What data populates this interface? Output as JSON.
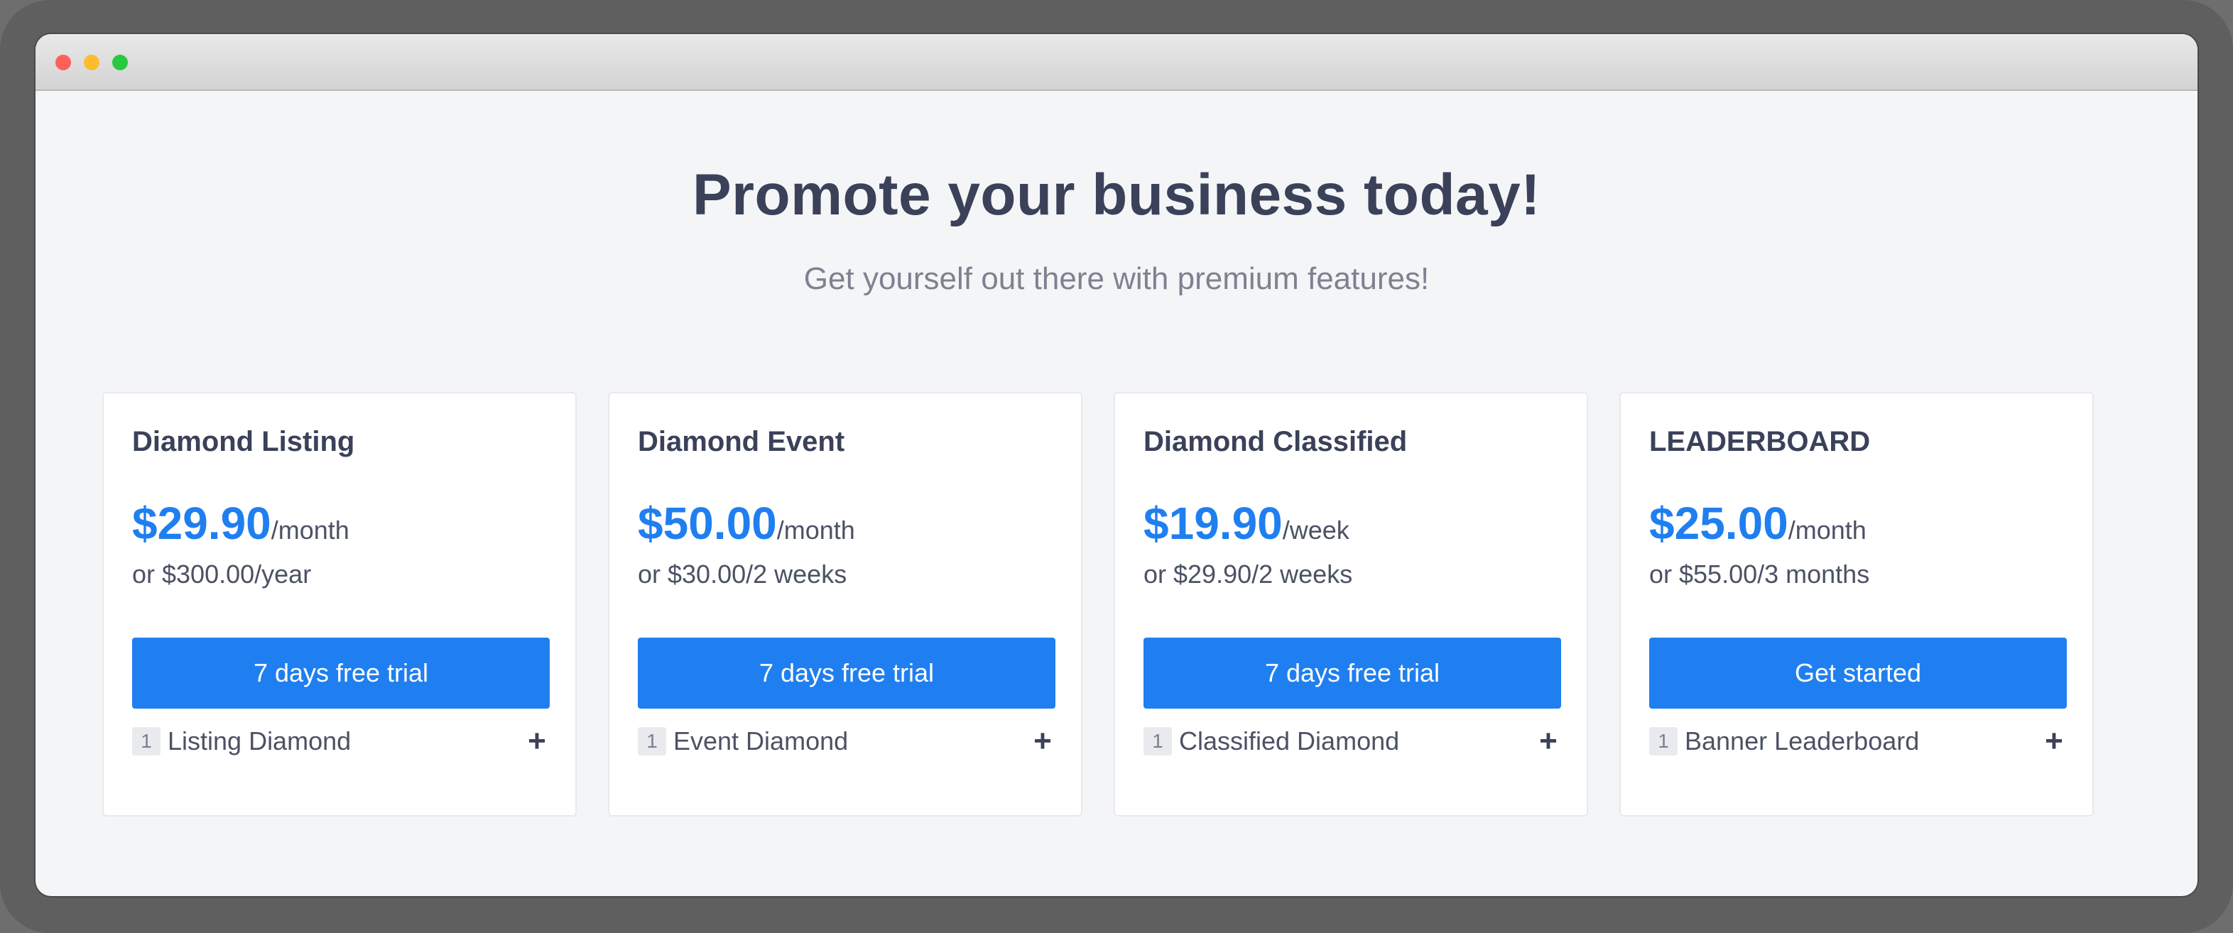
{
  "window": {
    "controls": [
      "close",
      "minimize",
      "maximize"
    ]
  },
  "hero": {
    "title": "Promote your business today!",
    "subtitle": "Get yourself out there with premium features!"
  },
  "plans": [
    {
      "name": "Diamond Listing",
      "price": "$29.90",
      "period": "/month",
      "alt_price": "or $300.00/year",
      "cta": "7 days free trial",
      "feature_qty": "1",
      "feature_label": "Listing Diamond"
    },
    {
      "name": "Diamond Event",
      "price": "$50.00",
      "period": "/month",
      "alt_price": "or $30.00/2 weeks",
      "cta": "7 days free trial",
      "feature_qty": "1",
      "feature_label": "Event Diamond"
    },
    {
      "name": "Diamond Classified",
      "price": "$19.90",
      "period": "/week",
      "alt_price": "or $29.90/2 weeks",
      "cta": "7 days free trial",
      "feature_qty": "1",
      "feature_label": "Classified Diamond"
    },
    {
      "name": "LEADERBOARD",
      "price": "$25.00",
      "period": "/month",
      "alt_price": "or $55.00/3 months",
      "cta": "Get started",
      "feature_qty": "1",
      "feature_label": "Banner Leaderboard"
    }
  ],
  "icons": {
    "expand": "plus-icon"
  },
  "colors": {
    "accent": "#1f7ff0",
    "heading": "#3a4159",
    "text": "#4c5264",
    "muted": "#7d8190",
    "background": "#f4f5f7",
    "card": "#ffffff"
  }
}
